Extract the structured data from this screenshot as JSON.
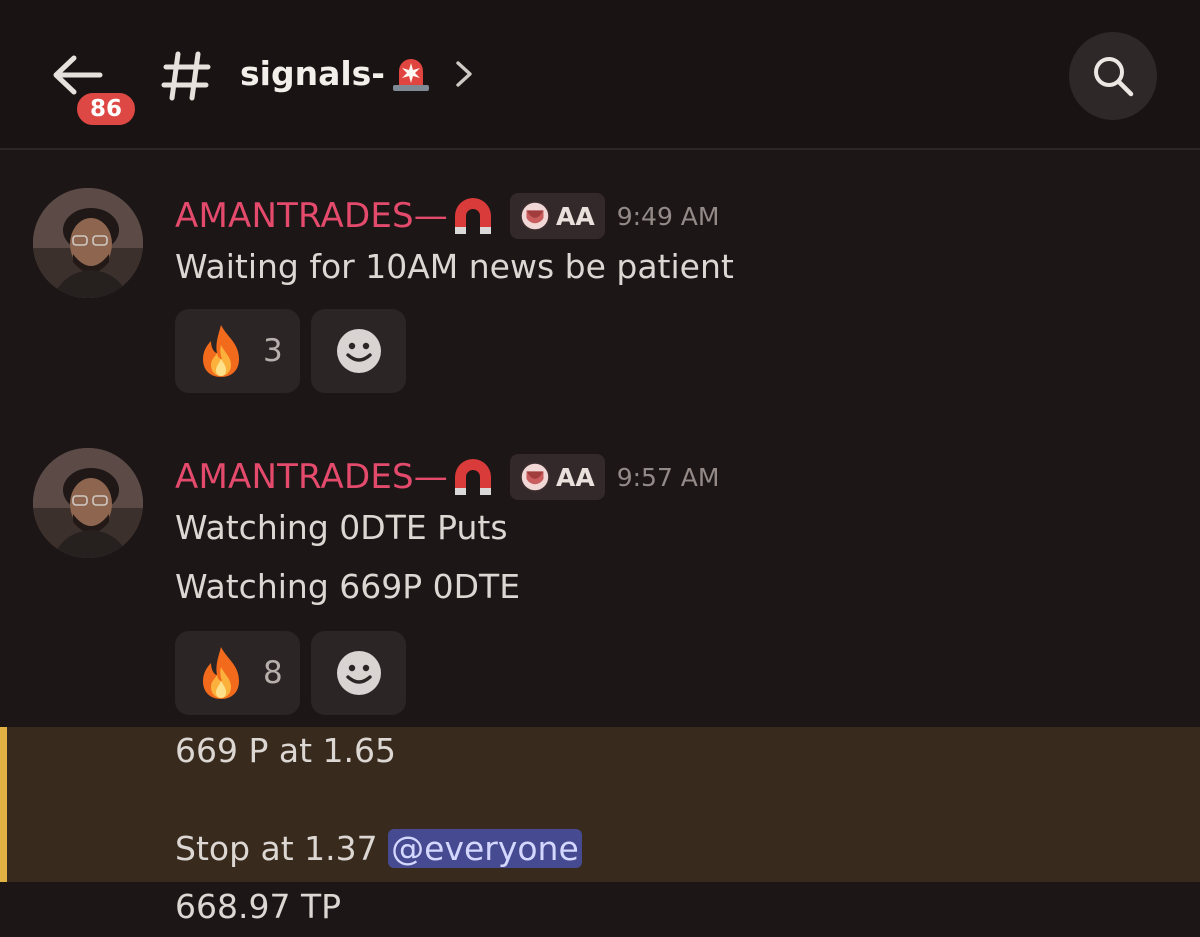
{
  "header": {
    "unread_badge": "86",
    "channel_name": "signals-",
    "channel_emoji": "rotating-light-icon"
  },
  "messages": [
    {
      "username": "AMANTRADES—",
      "role_tag": "AA",
      "time": "9:49 AM",
      "lines": [
        "Waiting for 10AM news be patient"
      ],
      "reactions": [
        {
          "emoji": "fire-icon",
          "count": "3"
        }
      ]
    },
    {
      "username": "AMANTRADES—",
      "role_tag": "AA",
      "time": "9:57 AM",
      "lines": [
        "Watching 0DTE Puts",
        "Watching 669P 0DTE"
      ],
      "reactions": [
        {
          "emoji": "fire-icon",
          "count": "8"
        }
      ]
    }
  ],
  "followups": {
    "line1": "669 P at 1.65",
    "line2_text": "Stop at 1.37 ",
    "line2_mention": "@everyone",
    "line3": "668.97 TP"
  },
  "colors": {
    "username": "#e44a6c",
    "badge": "#dd4844",
    "highlight_bg": "#382a1d",
    "highlight_bar": "#e1b143",
    "mention_bg": "#464a91"
  }
}
